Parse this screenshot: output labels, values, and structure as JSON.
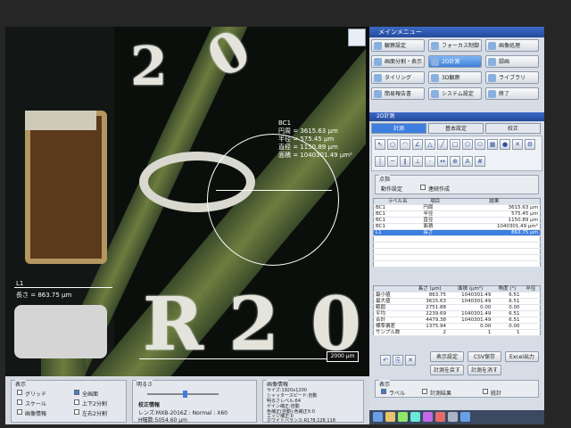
{
  "scope": {
    "silkscreen": [
      "2",
      "0",
      "R",
      "2",
      "0"
    ],
    "measurement": {
      "id": "BC1",
      "lines": [
        "円周 = 3615.63 μm",
        "半径 = 575.45 μm",
        "直径 = 1150.89 μm",
        "面積 = 1040301.49 μm²"
      ]
    },
    "length_label": {
      "id": "L1",
      "text": "長さ = 863.75 μm"
    },
    "scale_bar": "2000 μm"
  },
  "menu": {
    "title": "メインメニュー",
    "buttons": [
      {
        "label": "観察設定",
        "active": false
      },
      {
        "label": "フォーカス制御",
        "active": false
      },
      {
        "label": "画像処理",
        "active": false
      },
      {
        "label": "画面分割・表示",
        "active": false
      },
      {
        "label": "2D計測",
        "active": true
      },
      {
        "label": "録画",
        "active": false
      },
      {
        "label": "タイリング",
        "active": false
      },
      {
        "label": "3D観察",
        "active": false
      },
      {
        "label": "ライブラリ",
        "active": false
      },
      {
        "label": "簡易報告書",
        "active": false
      },
      {
        "label": "システム設定",
        "active": false
      },
      {
        "label": "終了",
        "active": false
      }
    ]
  },
  "measure2d": {
    "title": "2D計測",
    "tabs": [
      {
        "label": "計測",
        "active": true
      },
      {
        "label": "基本設定",
        "active": false
      },
      {
        "label": "校正",
        "active": false
      }
    ],
    "selection_group": "点指",
    "action_setting": "動作設定",
    "continuous_label": "連続作成",
    "results_headers": [
      "ラベル名",
      "項目",
      "結果"
    ],
    "results": [
      {
        "label": "BC1",
        "item": "円周",
        "value": "3615.63 μm",
        "selected": false
      },
      {
        "label": "BC1",
        "item": "半径",
        "value": "575.45 μm",
        "selected": false
      },
      {
        "label": "BC1",
        "item": "直径",
        "value": "1150.89 μm",
        "selected": false
      },
      {
        "label": "BC1",
        "item": "面積",
        "value": "1040301.49 μm²",
        "selected": false
      },
      {
        "label": "L1",
        "item": "長さ",
        "value": "863.75 μm",
        "selected": true
      }
    ],
    "stats_headers": [
      "",
      "長さ (μm)",
      "面積 (μm²)",
      "角度 (°)",
      "半径"
    ],
    "stats": [
      {
        "name": "最小値",
        "len": "863.75",
        "area": "1040301.49",
        "angle": "6.51"
      },
      {
        "name": "最大値",
        "len": "3615.63",
        "area": "1040301.49",
        "angle": "6.51"
      },
      {
        "name": "範囲",
        "len": "2751.88",
        "area": "0.00",
        "angle": "0.00"
      },
      {
        "name": "平均",
        "len": "2239.69",
        "area": "1040301.49",
        "angle": "6.51"
      },
      {
        "name": "合計",
        "len": "4479.38",
        "area": "1040301.49",
        "angle": "6.51"
      },
      {
        "name": "標準偏差",
        "len": "1375.94",
        "area": "0.00",
        "angle": "0.00"
      },
      {
        "name": "サンプル数",
        "len": "2",
        "area": "1",
        "angle": "1"
      }
    ],
    "buttons": {
      "table_settings": "表示設定",
      "csv_save": "CSV保存",
      "excel_output": "Excel出力",
      "recalc": "計測を戻す",
      "delete_all": "計測を消す"
    },
    "display_group": "表示",
    "label_check": "ラベル",
    "measure_value": "計測結果",
    "stats_check": "統計"
  },
  "bottom": {
    "display_group": "表示",
    "display_items": [
      "グリッド",
      "スケール",
      "画像情報"
    ],
    "split_items": [
      "全画面",
      "上下2分割",
      "左右2分割"
    ],
    "brightness_label": "明るさ",
    "calibration_title": "校正情報",
    "lens": "レンズ:MXB-2016Z : Normal : X60",
    "h_size": "H幅数:5054.60 μm",
    "image_info_title": "画像情報",
    "image_info": [
      "サイズ:1920x1200",
      "シャッタースピード:自動",
      "明るさレベル:64",
      "ゲイン補正:自動",
      "色補正(自動):色補正X:0",
      "エッジ補正:0",
      "ホワイトバランス:R178,128,118"
    ]
  }
}
